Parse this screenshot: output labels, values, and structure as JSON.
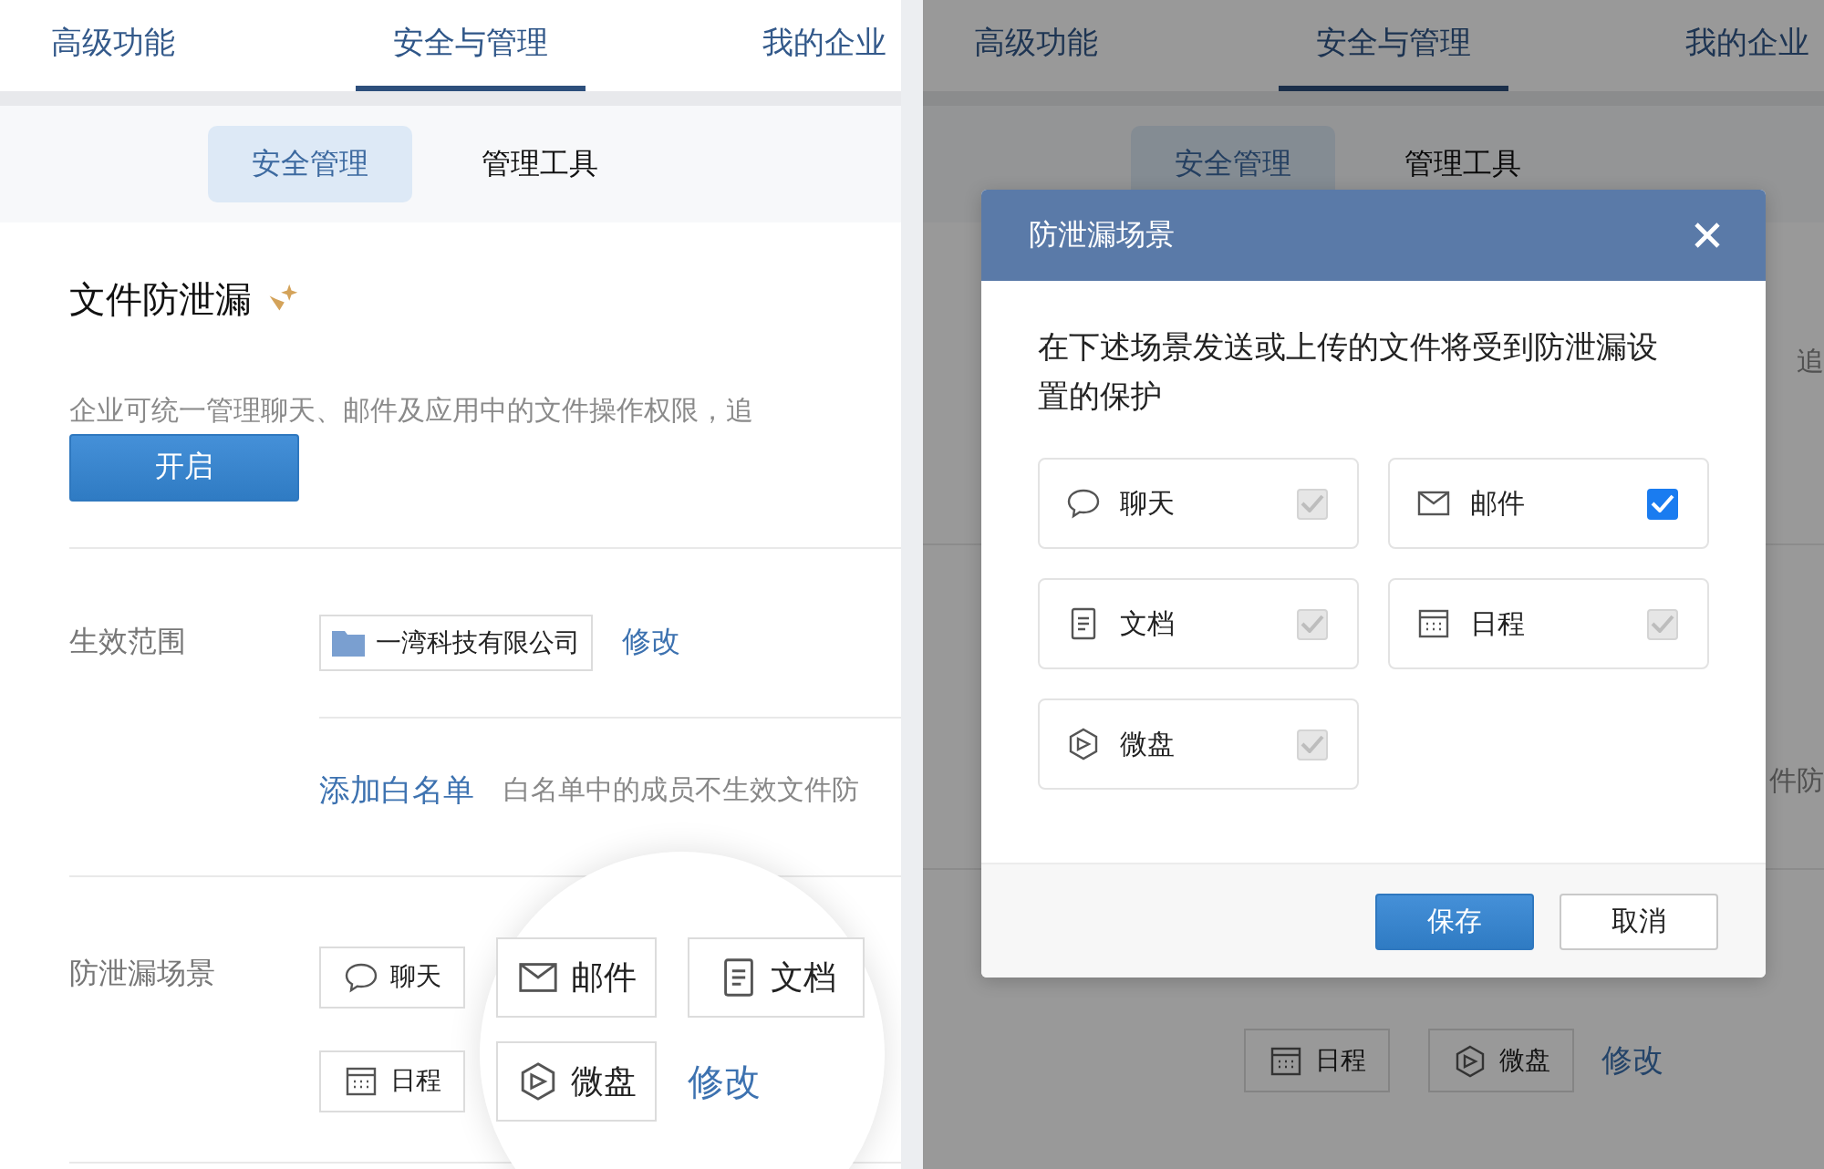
{
  "left_panel": {
    "tabs": [
      {
        "label": "高级功能",
        "selected": false
      },
      {
        "label": "安全与管理",
        "selected": true
      },
      {
        "label": "我的企业",
        "selected": false
      }
    ],
    "subtabs": [
      {
        "label": "安全管理",
        "selected": true
      },
      {
        "label": "管理工具",
        "selected": false
      }
    ],
    "title": "文件防泄漏",
    "description": "企业可统一管理聊天、邮件及应用中的文件操作权限，追",
    "enable_button": "开启",
    "scope": {
      "label": "生效范围",
      "org": "一湾科技有限公司",
      "edit_link": "修改"
    },
    "whitelist": {
      "link": "添加白名单",
      "note": "白名单中的成员不生效文件防"
    },
    "scenes": {
      "label": "防泄漏场景",
      "edit_link": "修改",
      "items": [
        {
          "kind": "chat",
          "label": "聊天",
          "magnified": false
        },
        {
          "kind": "mail",
          "label": "邮件",
          "magnified": true
        },
        {
          "kind": "doc",
          "label": "文档",
          "magnified": true
        },
        {
          "kind": "calendar",
          "label": "日程",
          "magnified": false
        },
        {
          "kind": "disk",
          "label": "微盘",
          "magnified": true
        }
      ]
    }
  },
  "right_panel": {
    "tabs": [
      {
        "label": "高级功能",
        "selected": false
      },
      {
        "label": "安全与管理",
        "selected": true
      },
      {
        "label": "我的企业",
        "selected": false
      }
    ],
    "subtabs": [
      {
        "label": "安全管理",
        "selected": true
      },
      {
        "label": "管理工具",
        "selected": false
      }
    ],
    "description_fragment": "追",
    "note_fragment": "件防",
    "scenes": {
      "edit_link": "修改",
      "items": [
        {
          "kind": "calendar",
          "label": "日程"
        },
        {
          "kind": "disk",
          "label": "微盘"
        }
      ]
    },
    "modal": {
      "title": "防泄漏场景",
      "message": "在下述场景发送或上传的文件将受到防泄漏设置的保护",
      "options": [
        {
          "kind": "chat",
          "label": "聊天",
          "checked": true,
          "disabled": true
        },
        {
          "kind": "mail",
          "label": "邮件",
          "checked": true,
          "disabled": false
        },
        {
          "kind": "doc",
          "label": "文档",
          "checked": true,
          "disabled": true
        },
        {
          "kind": "calendar",
          "label": "日程",
          "checked": true,
          "disabled": true
        },
        {
          "kind": "disk",
          "label": "微盘",
          "checked": true,
          "disabled": true
        }
      ],
      "buttons": [
        {
          "kind": "primary",
          "label": "保存"
        },
        {
          "kind": "secondary",
          "label": "取消"
        }
      ]
    }
  }
}
